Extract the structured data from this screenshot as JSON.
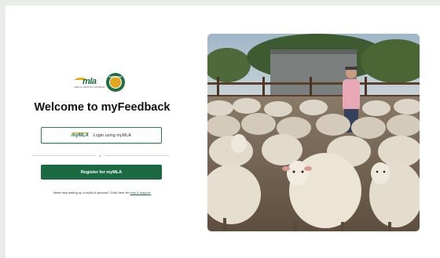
{
  "logos": {
    "mla": {
      "word": "mla",
      "tagline": "MEAT & LIVESTOCK AUSTRALIA"
    },
    "feedback": {
      "word": "FEEDBACK"
    }
  },
  "page": {
    "title": "Welcome to myFeedback"
  },
  "login": {
    "mini_logo": "myMLA",
    "label": "Login using myMLA"
  },
  "divider": {
    "text": "or"
  },
  "register": {
    "label": "Register for myMLA"
  },
  "help": {
    "text": "Need help setting up a myMLA account? Click here for ",
    "link": "help & support."
  },
  "photo": {
    "subject": "sheep in yard with farmer"
  },
  "colors": {
    "brand_green": "#1c6b40",
    "brand_gold": "#e6a619",
    "background": "#e9ece9"
  }
}
